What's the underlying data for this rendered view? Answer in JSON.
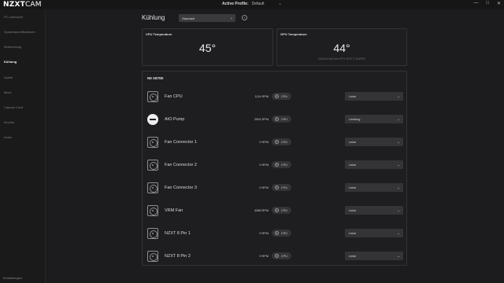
{
  "app": {
    "logo_bold": "NZXT",
    "logo_light": "CAM"
  },
  "titlebar": {
    "profile_key": "Active Profile:",
    "profile_value": "Default",
    "profile_chevron": "⌄",
    "win_minimize": "—",
    "win_maximize": "□",
    "win_close": "✕"
  },
  "sidebar": {
    "items": [
      {
        "label": "PC-Übersicht"
      },
      {
        "label": "Systemspezifikationen"
      },
      {
        "label": "Beleuchtung"
      },
      {
        "label": "Kühlung"
      },
      {
        "label": "Spiele"
      },
      {
        "label": "Mixer"
      },
      {
        "label": "Capture Card"
      },
      {
        "label": "Monitor"
      },
      {
        "label": "Audio"
      }
    ],
    "settings_label": "Einstellungen",
    "active_index": 3
  },
  "header": {
    "title": "Kühlung",
    "profile_select": "Standard",
    "select_arrow": "⌄"
  },
  "cpu_card": {
    "label": "CPU Temperature",
    "value": "45°"
  },
  "gpu_card": {
    "label": "GPU Temperature",
    "value": "44°",
    "subtitle": "NVIDIA GeForce RTX 4070 Ti SUPER"
  },
  "device": {
    "name": "N9 X870E",
    "rows": [
      {
        "icon": "fan-icon",
        "name": "Fan CPU",
        "rpm": "1114 RPM",
        "source": "CPU",
        "mode": "Leise"
      },
      {
        "icon": "pump-icon",
        "name": "AIO Pump",
        "rpm": "2504 RPM",
        "source": "CPU",
        "mode": "Leistung"
      },
      {
        "icon": "fan-icon",
        "name": "Fan Connector 1",
        "rpm": "0 RPM",
        "source": "CPU",
        "mode": "Leise"
      },
      {
        "icon": "fan-icon",
        "name": "Fan Connector 2",
        "rpm": "0 RPM",
        "source": "CPU",
        "mode": "Leise"
      },
      {
        "icon": "fan-icon",
        "name": "Fan Connector 3",
        "rpm": "0 RPM",
        "source": "CPU",
        "mode": "Leise"
      },
      {
        "icon": "fan-icon",
        "name": "VRM Fan",
        "rpm": "4388 RPM",
        "source": "CPU",
        "mode": "Leise"
      },
      {
        "icon": "fan-icon",
        "name": "NZXT 8 Pin 1",
        "rpm": "0 RPM",
        "source": "CPU",
        "mode": "Leise"
      },
      {
        "icon": "fan-icon",
        "name": "NZXT 8 Pin 2",
        "rpm": "0 RPM",
        "source": "CPU",
        "mode": "Leise"
      }
    ]
  }
}
